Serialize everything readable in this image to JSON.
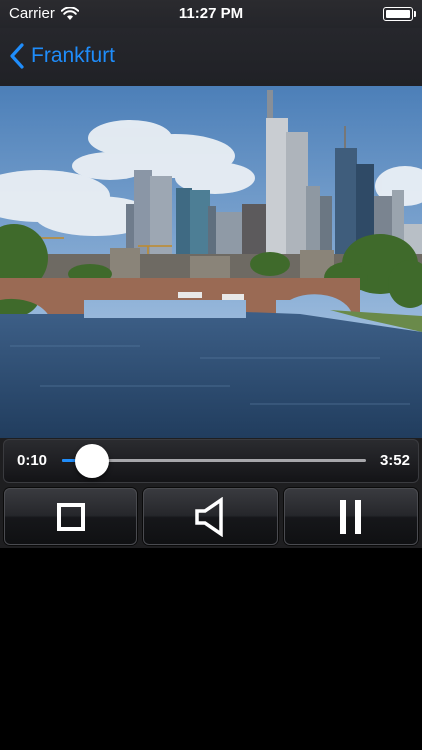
{
  "status_bar": {
    "carrier": "Carrier",
    "time": "11:27 PM",
    "icons": [
      "wifi-icon",
      "battery-icon"
    ]
  },
  "nav": {
    "back_label": "Frankfurt",
    "back_icon": "chevron-left-icon",
    "accent_color": "#1f8dfb"
  },
  "video": {
    "content": "frankfurt-skyline-river-bridge"
  },
  "player": {
    "current_time": "0:10",
    "total_time": "3:52",
    "progress": 0.1,
    "buttons": {
      "stop_icon": "stop-icon",
      "volume_icon": "speaker-icon",
      "pause_icon": "pause-icon"
    }
  }
}
